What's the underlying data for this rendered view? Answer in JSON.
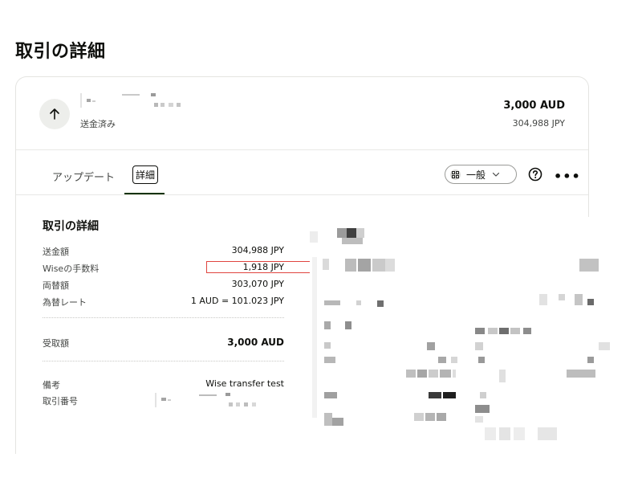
{
  "page": {
    "title": "取引の詳細"
  },
  "header": {
    "status": "送金済み",
    "amount_main": "3,000 AUD",
    "amount_sub": "304,988 JPY"
  },
  "tabs": {
    "updates": "アップデート",
    "details": "詳細",
    "view_label": "一般"
  },
  "icons": {
    "transfer": "arrow-up-icon",
    "view": "grid-icon",
    "dropdown": "chevron-down-icon",
    "help": "question-circle-icon",
    "more": "more-horizontal-icon"
  },
  "details": {
    "title": "取引の詳細",
    "rows": [
      {
        "label": "送金額",
        "value": "304,988 JPY"
      },
      {
        "label": "Wiseの手数料",
        "value": "1,918 JPY"
      },
      {
        "label": "両替額",
        "value": "303,070 JPY"
      },
      {
        "label": "為替レート",
        "value": "1 AUD = 101.023 JPY"
      },
      {
        "label": "受取額",
        "value": "3,000 AUD"
      },
      {
        "label": "備考",
        "value": "Wise transfer test"
      },
      {
        "label": "取引番号",
        "value": ""
      }
    ]
  },
  "colors": {
    "highlight": "#e0453f",
    "tab_underline": "#163300",
    "text": "#0e0f0c"
  }
}
